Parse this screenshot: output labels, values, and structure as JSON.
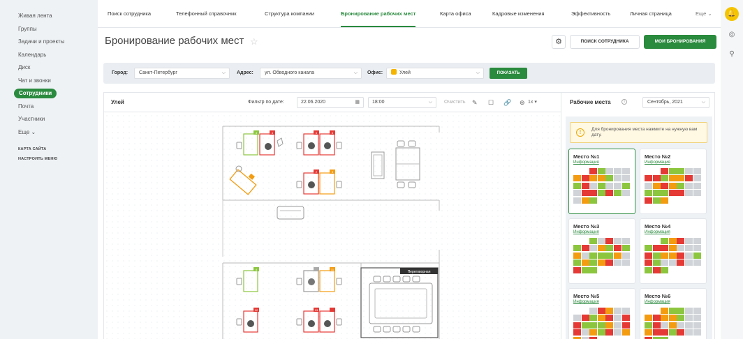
{
  "sidebar": {
    "items": [
      {
        "label": "Живая лента"
      },
      {
        "label": "Группы"
      },
      {
        "label": "Задачи и проекты"
      },
      {
        "label": "Календарь"
      },
      {
        "label": "Диск"
      },
      {
        "label": "Чат и звонки"
      },
      {
        "label": "Сотрудники",
        "active": true
      },
      {
        "label": "Почта"
      },
      {
        "label": "Участники"
      },
      {
        "label": "Еще ⌄"
      }
    ],
    "sitemap": "КАРТА САЙТА",
    "configure_menu": "НАСТРОИТЬ МЕНЮ"
  },
  "topnav": {
    "items": [
      "Поиск сотрудника",
      "Телефонный справочник",
      "Структура компании",
      "Бронирование рабочих мест",
      "Карта офиса",
      "Кадровые изменения",
      "Эффективность",
      "Личная страница",
      "Еще ⌄"
    ],
    "active_index": 3
  },
  "header": {
    "title": "Бронирование рабочих мест",
    "search_employee_btn": "ПОИСК СОТРУДНИКА",
    "my_bookings_btn": "МОИ БРОНИРОВАНИЯ"
  },
  "filters": {
    "city_label": "Город:",
    "city_value": "Санкт-Петербург",
    "address_label": "Адрес:",
    "address_value": "ул. Обводного канала",
    "office_label": "Офис:",
    "office_value": "Улей",
    "show_btn": "ПОКАЗАТЬ"
  },
  "map": {
    "office_name": "Улей",
    "date_filter_label": "Фильтр по дате:",
    "date_value": "22.06.2020",
    "time_value": "18:00",
    "clear_label": "Очистить",
    "zoom_value": "1x",
    "meeting_room_label": "Переговорная",
    "desk_numbers": [
      "3",
      "4",
      "5",
      "6",
      "2",
      "3",
      "8",
      "11",
      "12",
      "13"
    ]
  },
  "right_panel": {
    "title": "Рабочие места",
    "month_value": "Сентябрь, 2021",
    "hint": "Для бронирования места нажмите на нужную вам дату.",
    "info_link": "Информация",
    "seats": [
      "Место №1",
      "Место №2",
      "Место №3",
      "Место №4",
      "Место №5",
      "Место №6"
    ]
  },
  "colors": {
    "accent": "#2a8a3e",
    "free": "#8cc63f",
    "busy": "#e53935",
    "partial": "#f39c12",
    "inactive": "#d0d4d8"
  }
}
